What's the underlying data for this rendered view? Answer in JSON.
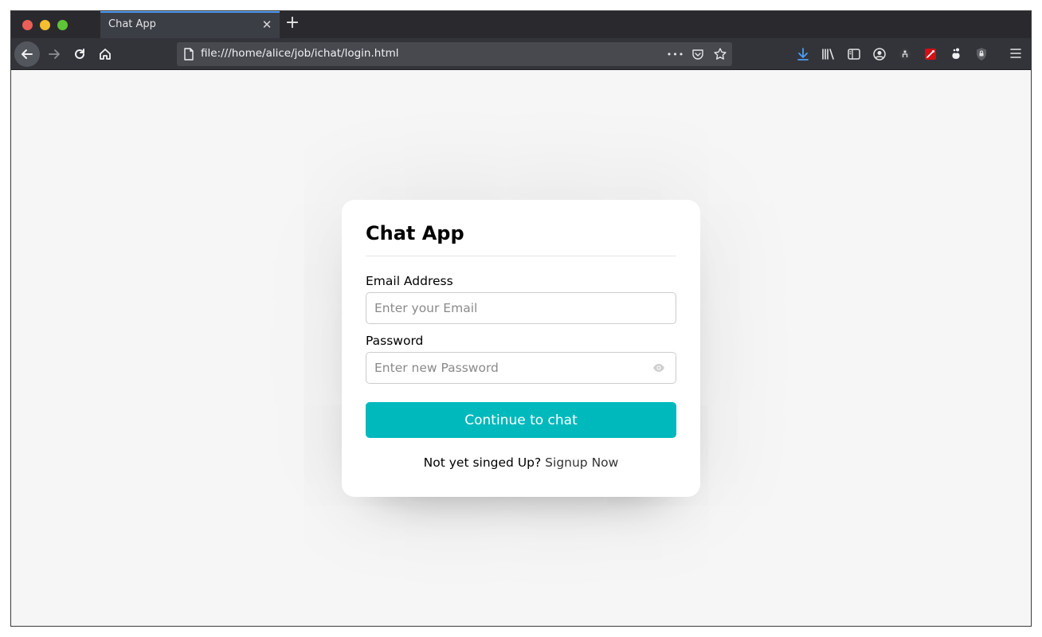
{
  "browser": {
    "tab": {
      "title": "Chat App",
      "close_symbol": "✕"
    },
    "new_tab_symbol": "+",
    "url": "file:///home/alice/job/ichat/login.html",
    "url_actions_dots": "•••",
    "accent_color": "#4f9cf4"
  },
  "card": {
    "title": "Chat App",
    "email": {
      "label": "Email Address",
      "placeholder": "Enter your Email",
      "value": ""
    },
    "password": {
      "label": "Password",
      "placeholder": "Enter new Password",
      "value": ""
    },
    "submit_label": "Continue to chat",
    "signup_prompt": "Not yet singed Up?",
    "signup_link": "Signup Now"
  },
  "colors": {
    "primary_button": "#00b9bc",
    "page_background": "#f6f6f6"
  }
}
